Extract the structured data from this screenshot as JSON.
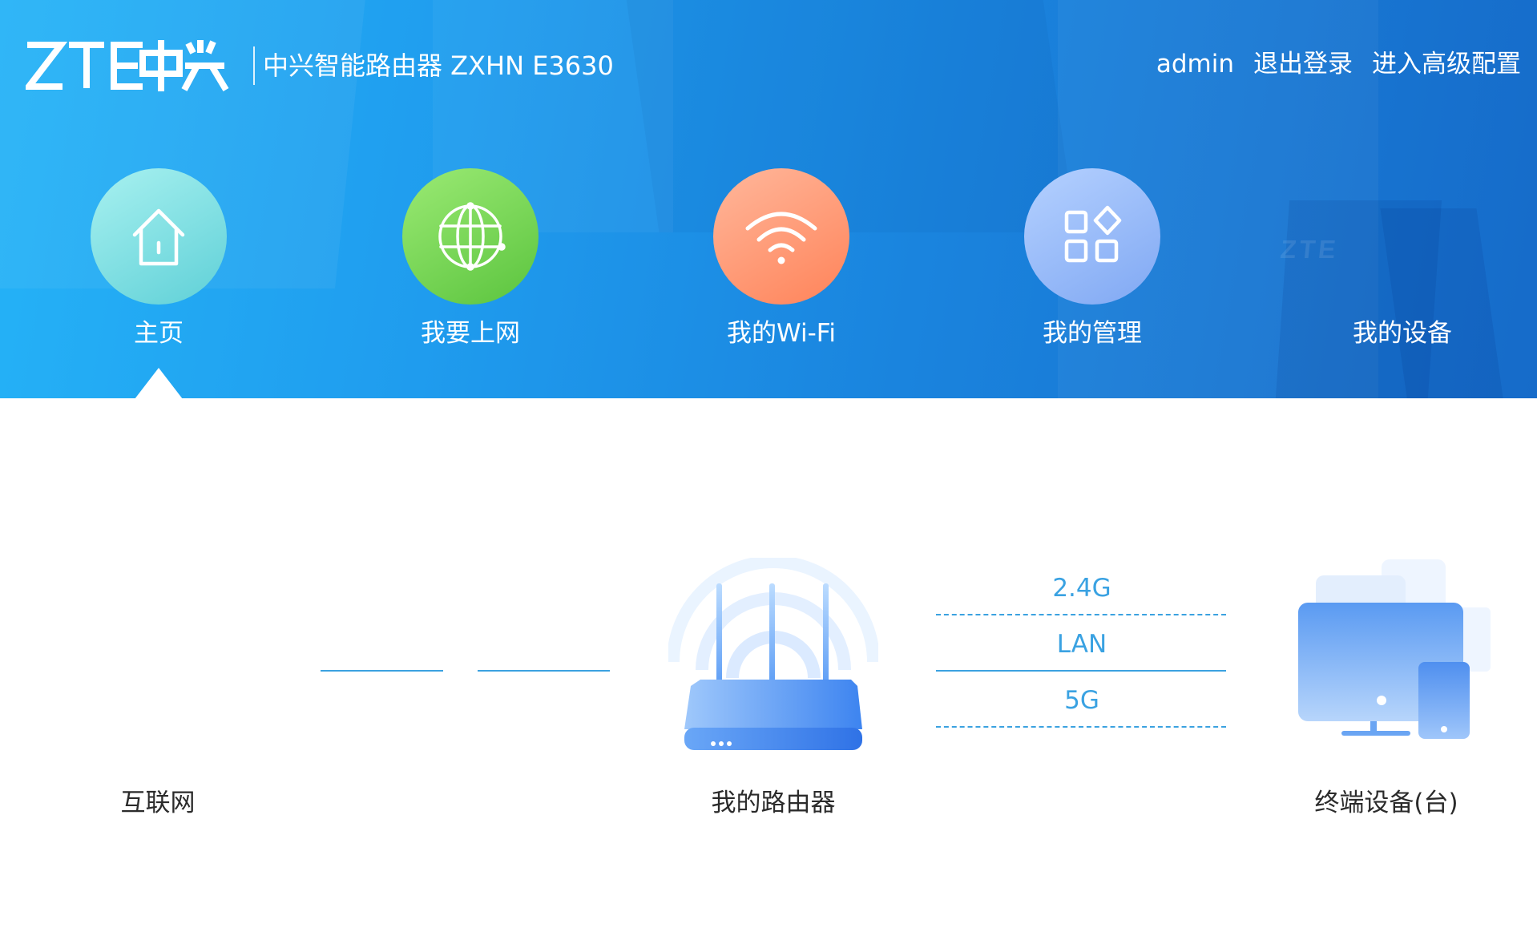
{
  "header": {
    "brand": "ZTE中兴",
    "product_title": "中兴智能路由器 ZXHN E3630",
    "bg_watermark": "ZTE",
    "links": {
      "user": "admin",
      "logout": "退出登录",
      "advanced": "进入高级配置"
    }
  },
  "nav": {
    "active": "home",
    "items": [
      {
        "key": "home",
        "label": "主页",
        "icon": "home-icon"
      },
      {
        "key": "internet",
        "label": "我要上网",
        "icon": "globe-icon"
      },
      {
        "key": "wifi",
        "label": "我的Wi-Fi",
        "icon": "wifi-icon"
      },
      {
        "key": "manage",
        "label": "我的管理",
        "icon": "apps-icon"
      },
      {
        "key": "devices",
        "label": "我的设备",
        "icon": ""
      }
    ]
  },
  "topology": {
    "internet_label": "互联网",
    "router_label": "我的路由器",
    "devices_label": "终端设备(台)",
    "bands": {
      "band_24g": "2.4G",
      "lan": "LAN",
      "band_5g": "5G"
    }
  },
  "colors": {
    "header_start": "#25b3f7",
    "header_end": "#166bc9",
    "accent": "#3aa2e2",
    "home_circle": "#5fd0d7",
    "internet_circle": "#5bc43e",
    "wifi_circle": "#ff8359",
    "manage_circle": "#80a8f3"
  }
}
